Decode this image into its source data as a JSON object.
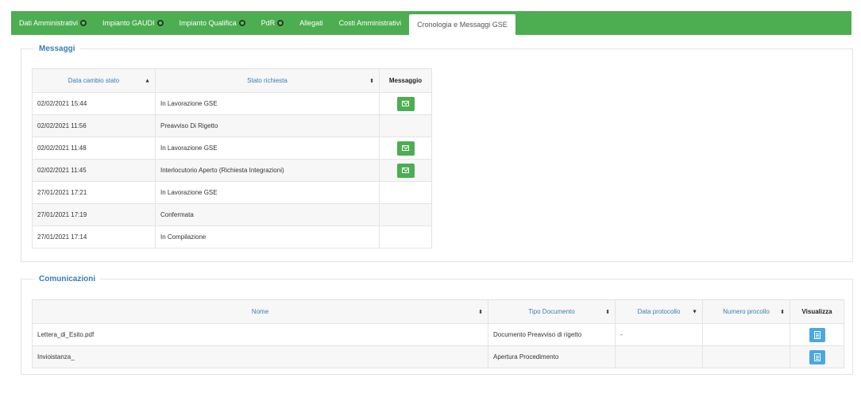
{
  "tabs": [
    {
      "label": "Dati Amministrativi",
      "status": true,
      "active": false
    },
    {
      "label": "Impianto GAUDI",
      "status": true,
      "active": false
    },
    {
      "label": "Impianto Qualifica",
      "status": true,
      "active": false
    },
    {
      "label": "PdR",
      "status": true,
      "active": false
    },
    {
      "label": "Allegati",
      "status": false,
      "active": false
    },
    {
      "label": "Costi Amministrativi",
      "status": false,
      "active": false
    },
    {
      "label": "Cronologia e Messaggi GSE",
      "status": false,
      "active": true
    }
  ],
  "messaggi": {
    "legend": "Messaggi",
    "headers": {
      "date": "Data cambio stato",
      "status": "Stato richiesta",
      "message": "Messaggio"
    },
    "sort_icons": {
      "date": "▲",
      "status": "⬍"
    },
    "rows": [
      {
        "date": "02/02/2021 15:44",
        "status": "In Lavorazione GSE",
        "has_message": true
      },
      {
        "date": "02/02/2021 11:56",
        "status": "Preavviso Di Rigetto",
        "has_message": false
      },
      {
        "date": "02/02/2021 11:48",
        "status": "In Lavorazione GSE",
        "has_message": true
      },
      {
        "date": "02/02/2021 11:45",
        "status": "Interlocutorio Aperto (Richiesta Integrazioni)",
        "has_message": true
      },
      {
        "date": "27/01/2021 17:21",
        "status": "In Lavorazione GSE",
        "has_message": false
      },
      {
        "date": "27/01/2021 17:19",
        "status": "Confermata",
        "has_message": false
      },
      {
        "date": "27/01/2021 17:14",
        "status": "In Compilazione",
        "has_message": false
      }
    ]
  },
  "comunicazioni": {
    "legend": "Comunicazioni",
    "headers": {
      "name": "Nome",
      "doc_type": "Tipo Documento",
      "protocol_date": "Data protocollo",
      "protocol_number": "Numero procollo",
      "view": "Visualizza"
    },
    "sort_icons": {
      "name": "⬍",
      "doc_type": "⬍",
      "protocol_date": "▼",
      "protocol_number": "⬍"
    },
    "rows": [
      {
        "name": "Lettera_di_Esito.pdf",
        "doc_type": "Documento Preavviso di rigetto",
        "protocol_date": "-",
        "protocol_number": ""
      },
      {
        "name": "Invioistanza_",
        "doc_type": "Apertura Procedimento",
        "protocol_date": "",
        "protocol_number": ""
      }
    ]
  }
}
